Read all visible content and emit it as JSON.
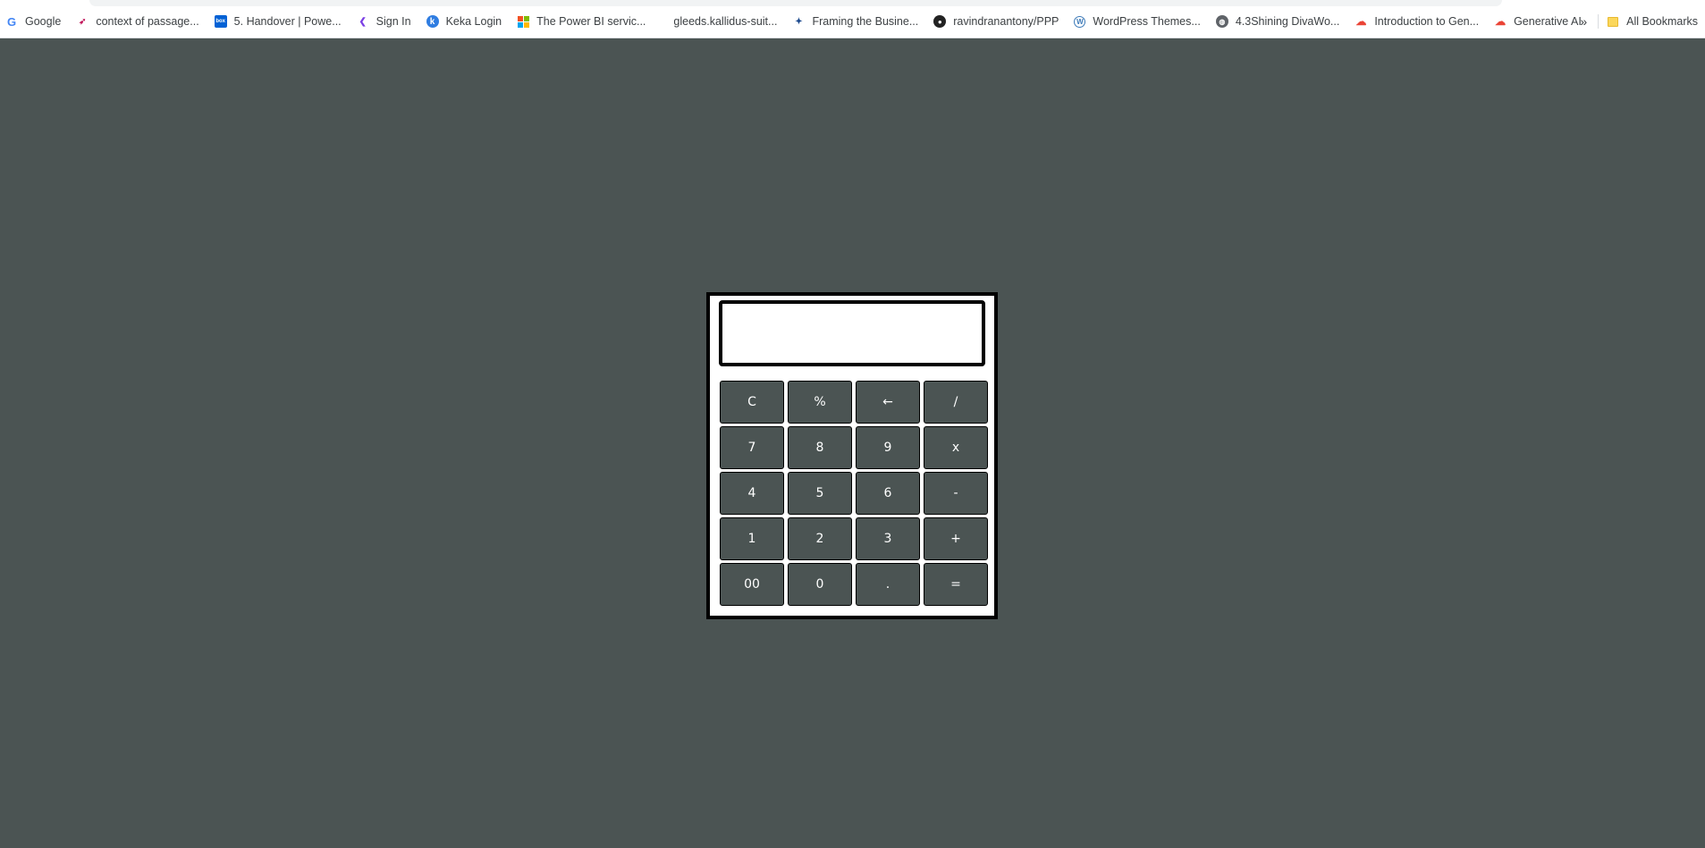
{
  "bookmarks": [
    {
      "label": "Google",
      "icon": "google-icon"
    },
    {
      "label": "context of passage...",
      "icon": "rocket-icon"
    },
    {
      "label": "5. Handover | Powe...",
      "icon": "box-icon"
    },
    {
      "label": "Sign In",
      "icon": "signin-icon"
    },
    {
      "label": "Keka Login",
      "icon": "keka-icon"
    },
    {
      "label": "The Power BI servic...",
      "icon": "microsoft-icon"
    },
    {
      "label": "gleeds.kallidus-suit...",
      "icon": "blank-icon"
    },
    {
      "label": "Framing the Busine...",
      "icon": "framing-icon"
    },
    {
      "label": "ravindranantony/PPP",
      "icon": "github-icon"
    },
    {
      "label": "WordPress Themes...",
      "icon": "wordpress-icon"
    },
    {
      "label": "4.3Shining DivaWo...",
      "icon": "globe-icon"
    },
    {
      "label": "Introduction to Gen...",
      "icon": "google-cloud-icon"
    },
    {
      "label": "Generative AI",
      "icon": "google-cloud-icon"
    }
  ],
  "bookmarks_right": {
    "overflow": "»",
    "all_bookmarks": "All Bookmarks"
  },
  "calculator": {
    "display_value": "",
    "keys": [
      [
        "C",
        "%",
        "←",
        "/"
      ],
      [
        "7",
        "8",
        "9",
        "x"
      ],
      [
        "4",
        "5",
        "6",
        "-"
      ],
      [
        "1",
        "2",
        "3",
        "+"
      ],
      [
        "00",
        "0",
        ".",
        "="
      ]
    ]
  },
  "colors": {
    "page_background": "#4b5453",
    "key_background": "#4b5453",
    "calculator_background": "#ffffff",
    "border": "#000000"
  }
}
